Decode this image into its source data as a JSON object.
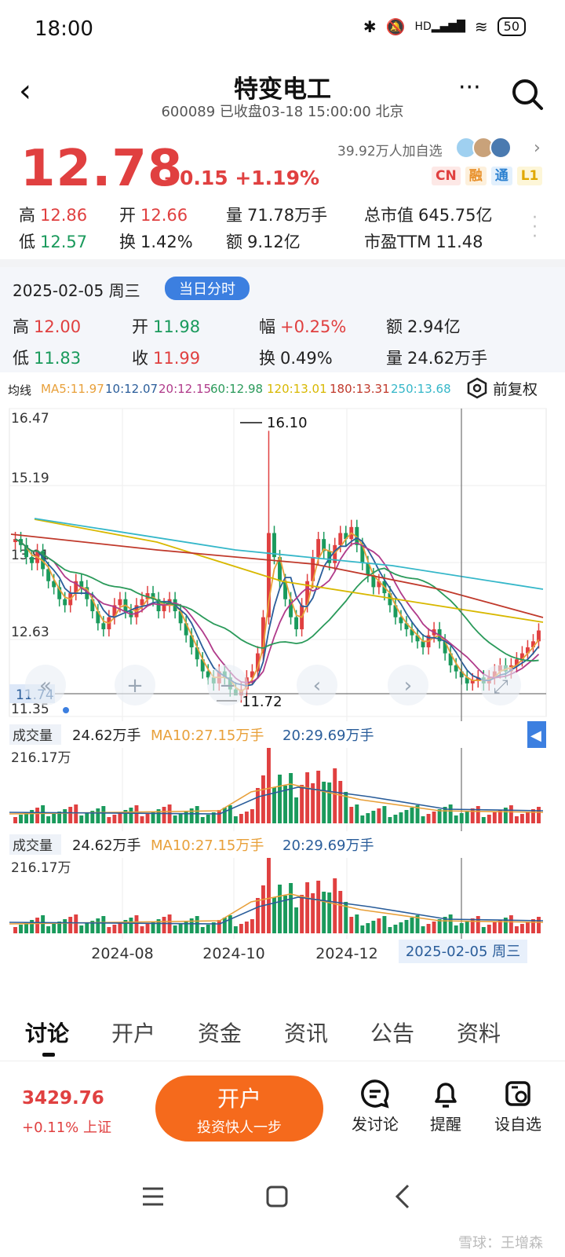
{
  "status": {
    "time": "18:00",
    "battery": "50",
    "hd": "HD"
  },
  "header": {
    "title": "特变电工",
    "subtitle": "600089 已收盘03-18 15:00:00 北京",
    "more": "···"
  },
  "quote": {
    "price": "12.78",
    "change": "+0.15 +1.19%",
    "followers": "39.92万人加自选",
    "tags": [
      "CN",
      "融",
      "通",
      "L1"
    ],
    "stats": [
      {
        "label": "高",
        "value": "12.86",
        "color": "red"
      },
      {
        "label": "开",
        "value": "12.66",
        "color": "red"
      },
      {
        "label": "量",
        "value": "71.78万手",
        "color": ""
      },
      {
        "label": "总市值",
        "value": "645.75亿",
        "color": ""
      },
      {
        "label": "低",
        "value": "12.57",
        "color": "green"
      },
      {
        "label": "换",
        "value": "1.42%",
        "color": ""
      },
      {
        "label": "额",
        "value": "9.12亿",
        "color": ""
      },
      {
        "label": "市盈TTM",
        "value": "11.48",
        "color": ""
      }
    ]
  },
  "day": {
    "date": "2025-02-05 周三",
    "button": "当日分时",
    "stats": [
      {
        "label": "高",
        "value": "12.00",
        "color": "red"
      },
      {
        "label": "开",
        "value": "11.98",
        "color": "green"
      },
      {
        "label": "幅",
        "value": "+0.25%",
        "color": "red"
      },
      {
        "label": "额",
        "value": "2.94亿",
        "color": ""
      },
      {
        "label": "低",
        "value": "11.83",
        "color": "green"
      },
      {
        "label": "收",
        "value": "11.99",
        "color": "red"
      },
      {
        "label": "换",
        "value": "0.49%",
        "color": ""
      },
      {
        "label": "量",
        "value": "24.62万手",
        "color": ""
      }
    ]
  },
  "ma_bar": {
    "label": "均线",
    "items": [
      {
        "text": "MA5:11.97",
        "color": "#e8a03a"
      },
      {
        "text": "10:12.07",
        "color": "#2a5d9a"
      },
      {
        "text": "20:12.15",
        "color": "#b03a8a"
      },
      {
        "text": "60:12.98",
        "color": "#2a9a5a"
      },
      {
        "text": "120:13.01",
        "color": "#d8b800"
      },
      {
        "text": "180:13.31",
        "color": "#c0392b"
      },
      {
        "text": "250:13.68",
        "color": "#35b7c9"
      }
    ],
    "adjust": "前复权"
  },
  "chart_data": {
    "type": "candlestick",
    "y_ticks": [
      "16.47",
      "15.19",
      "13.91",
      "12.63",
      "11.35"
    ],
    "x_ticks": [
      "2024-08",
      "2024-10",
      "2024-12"
    ],
    "max_label": "16.10",
    "min_label": "11.72",
    "crosshair_price": "11.74",
    "crosshair_date": "2025-02-05 周三",
    "close": [
      14.3,
      14.2,
      14.0,
      13.9,
      14.1,
      13.8,
      13.6,
      13.5,
      13.3,
      13.2,
      13.4,
      13.6,
      13.5,
      13.3,
      13.1,
      12.9,
      12.8,
      13.0,
      13.2,
      13.3,
      13.1,
      13.0,
      13.2,
      13.3,
      13.4,
      13.3,
      13.1,
      13.2,
      13.3,
      13.1,
      12.9,
      12.7,
      12.5,
      12.3,
      12.1,
      12.0,
      11.9,
      12.1,
      12.0,
      11.8,
      11.7,
      11.8,
      12.0,
      12.1,
      12.4,
      13.0,
      14.4,
      14.0,
      13.6,
      13.3,
      13.0,
      12.8,
      13.2,
      13.6,
      14.0,
      14.3,
      14.1,
      13.9,
      14.2,
      14.4,
      14.3,
      14.5,
      14.2,
      13.9,
      13.7,
      13.5,
      13.6,
      13.4,
      13.2,
      13.0,
      12.9,
      12.8,
      12.7,
      12.6,
      12.5,
      12.7,
      12.8,
      12.6,
      12.4,
      12.2,
      12.1,
      12.0,
      11.9,
      11.95,
      12.0,
      11.9,
      12.0,
      12.1,
      12.2,
      12.1,
      12.2,
      12.3,
      12.4,
      12.5,
      12.6,
      12.78
    ],
    "volume_label": "成交量",
    "volume_stats": [
      "24.62万手",
      "MA10:27.15万手",
      "20:29.69万手"
    ],
    "volume_max": "216.17万"
  },
  "tabs": [
    "讨论",
    "开户",
    "资金",
    "资讯",
    "公告",
    "资料"
  ],
  "bottom": {
    "index_value": "3429.76",
    "index_change": "+0.11% 上证",
    "open_title": "开户",
    "open_sub": "投资快人一步",
    "actions": [
      "发讨论",
      "提醒",
      "设自选"
    ]
  },
  "watermark": "雪球：王增森"
}
